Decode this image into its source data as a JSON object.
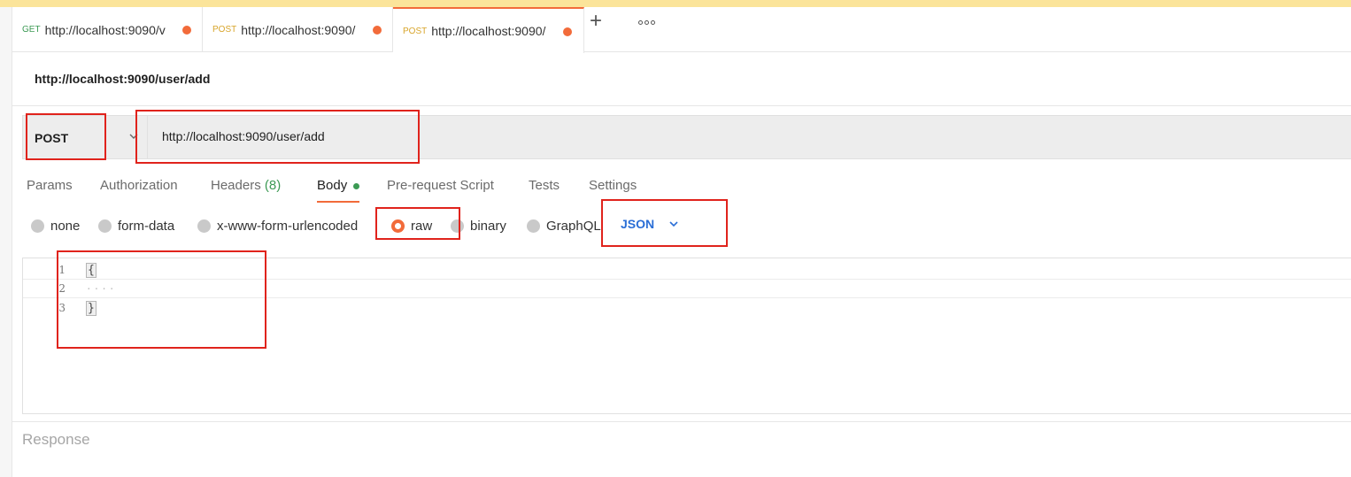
{
  "colors": {
    "accent": "#f26b3a",
    "get_method": "#3c9a54",
    "post_method": "#d8a52b",
    "json_link": "#2a6ed6",
    "annotation": "#e0231c",
    "top_banner": "#fbe49a"
  },
  "tabs": [
    {
      "method": "GET",
      "url": "http://localhost:9090/v",
      "unsaved": true,
      "active": false
    },
    {
      "method": "POST",
      "url": "http://localhost:9090/",
      "unsaved": true,
      "active": false
    },
    {
      "method": "POST",
      "url": "http://localhost:9090/",
      "unsaved": true,
      "active": true
    }
  ],
  "tab_actions": {
    "add_icon": "plus-icon",
    "more_icon": "more-options-icon"
  },
  "request": {
    "title": "http://localhost:9090/user/add",
    "method": "POST",
    "url": "http://localhost:9090/user/add"
  },
  "subtabs": {
    "params": "Params",
    "authorization": "Authorization",
    "headers": "Headers",
    "headers_count": "(8)",
    "body": "Body",
    "pre_request": "Pre-request Script",
    "tests": "Tests",
    "settings": "Settings",
    "active": "Body"
  },
  "body_types": {
    "none": "none",
    "form_data": "form-data",
    "urlencoded": "x-www-form-urlencoded",
    "raw": "raw",
    "binary": "binary",
    "graphql": "GraphQL",
    "selected": "raw",
    "format": "JSON"
  },
  "editor": {
    "lines": [
      {
        "number": "1",
        "text": "{"
      },
      {
        "number": "2",
        "text": "····"
      },
      {
        "number": "3",
        "text": "}"
      }
    ]
  },
  "response": {
    "label": "Response"
  }
}
